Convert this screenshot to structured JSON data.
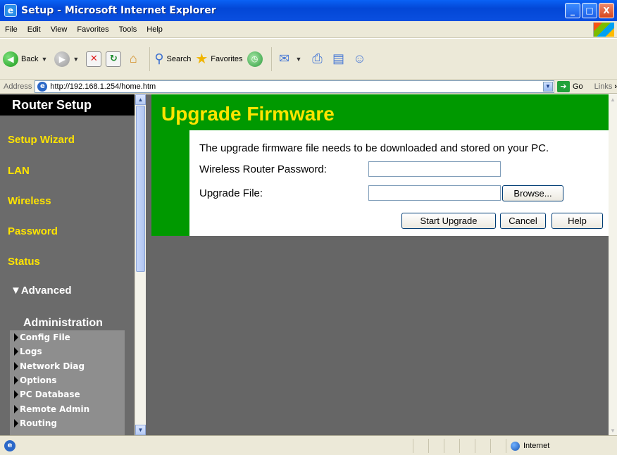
{
  "window": {
    "title": "Setup - Microsoft Internet Explorer",
    "min": "_",
    "max": "□",
    "close": "X"
  },
  "menu": [
    "File",
    "Edit",
    "View",
    "Favorites",
    "Tools",
    "Help"
  ],
  "toolbar": {
    "back": "Back",
    "search": "Search",
    "favorites": "Favorites"
  },
  "address": {
    "label": "Address",
    "url": "http://192.168.1.254/home.htm",
    "go": "Go",
    "links": "Links"
  },
  "sidebar": {
    "title": "Router Setup",
    "items": [
      "Setup Wizard",
      "LAN",
      "Wireless",
      "Password",
      "Status"
    ],
    "advanced": "▼Advanced",
    "section": "Administration",
    "sub_items": [
      "Config File",
      "Logs",
      "Network Diag",
      "Options",
      "PC Database",
      "Remote Admin",
      "Routing"
    ]
  },
  "content": {
    "heading": "Upgrade Firmware",
    "description": "The upgrade firmware file needs to be downloaded and stored on your PC.",
    "password_label": "Wireless Router Password:",
    "password_value": "",
    "file_label": "Upgrade File:",
    "file_value": "",
    "browse": "Browse...",
    "start": "Start Upgrade",
    "cancel": "Cancel",
    "help": "Help"
  },
  "status": {
    "zone": "Internet"
  },
  "colors": {
    "heading_bg": "#009900",
    "accent_yellow": "#ffe400",
    "sidebar_bg": "#6b6b6b"
  }
}
